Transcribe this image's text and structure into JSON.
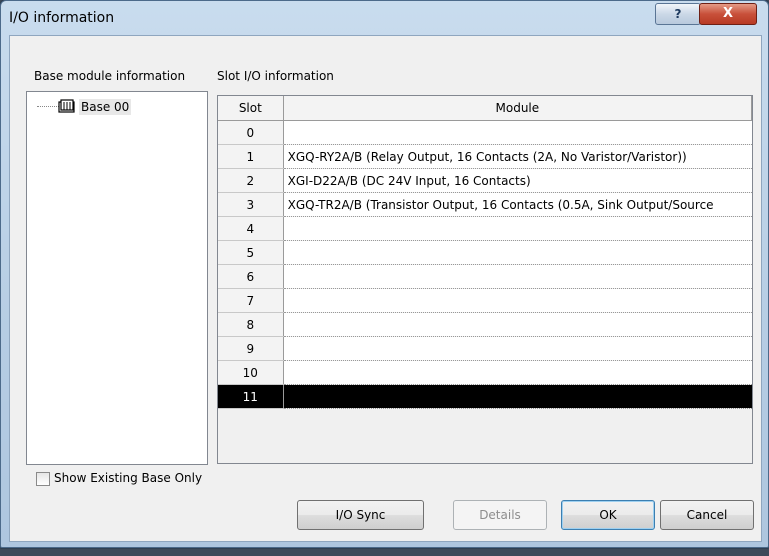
{
  "window": {
    "title": "I/O information",
    "help_label": "?",
    "close_label": "X"
  },
  "base_panel": {
    "label": "Base module information",
    "items": [
      {
        "label": "Base 00"
      }
    ]
  },
  "slot_panel": {
    "label": "Slot I/O information",
    "columns": [
      "Slot",
      "Module"
    ],
    "rows": [
      {
        "slot": "0",
        "module": ""
      },
      {
        "slot": "1",
        "module": "XGQ-RY2A/B (Relay Output, 16 Contacts (2A, No Varistor/Varistor))"
      },
      {
        "slot": "2",
        "module": "XGI-D22A/B (DC 24V Input, 16 Contacts)"
      },
      {
        "slot": "3",
        "module": "XGQ-TR2A/B (Transistor Output, 16 Contacts (0.5A, Sink Output/Source"
      },
      {
        "slot": "4",
        "module": ""
      },
      {
        "slot": "5",
        "module": ""
      },
      {
        "slot": "6",
        "module": ""
      },
      {
        "slot": "7",
        "module": ""
      },
      {
        "slot": "8",
        "module": ""
      },
      {
        "slot": "9",
        "module": ""
      },
      {
        "slot": "10",
        "module": ""
      },
      {
        "slot": "11",
        "module": ""
      }
    ],
    "selected_slot": "11"
  },
  "options": {
    "show_existing_label": "Show Existing Base Only",
    "show_existing_checked": false
  },
  "buttons": {
    "io_sync": "I/O Sync",
    "details": "Details",
    "ok": "OK",
    "cancel": "Cancel"
  }
}
